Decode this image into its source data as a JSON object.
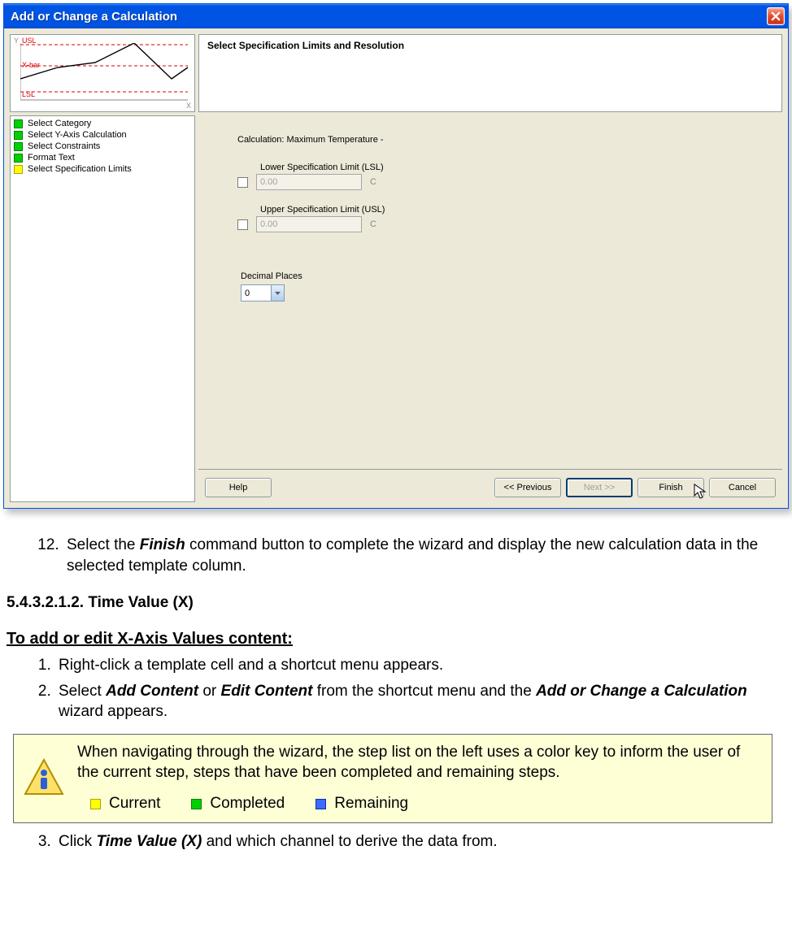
{
  "dialog": {
    "title": "Add or Change a Calculation",
    "header": "Select Specification Limits and Resolution",
    "chart": {
      "y": "Y",
      "usl": "USL",
      "xbar": "X-bar",
      "lsl": "LSL",
      "x": "X"
    },
    "steps": [
      {
        "color": "green",
        "label": "Select Category"
      },
      {
        "color": "green",
        "label": "Select Y-Axis Calculation"
      },
      {
        "color": "green",
        "label": "Select Constraints"
      },
      {
        "color": "green",
        "label": "Format Text"
      },
      {
        "color": "yellow",
        "label": "Select Specification Limits"
      }
    ],
    "form": {
      "calc_label": "Calculation: Maximum Temperature -",
      "lsl_label": "Lower Specification Limit (LSL)",
      "lsl_value": "0.00",
      "lsl_unit": "C",
      "usl_label": "Upper Specification Limit (USL)",
      "usl_value": "0.00",
      "usl_unit": "C",
      "decimal_label": "Decimal Places",
      "decimal_value": "0"
    },
    "buttons": {
      "help": "Help",
      "prev": "<< Previous",
      "next": "Next >>",
      "finish": "Finish",
      "cancel": "Cancel"
    }
  },
  "doc": {
    "step12_num": "12)",
    "step12_pre": "Select the ",
    "step12_bi": "Finish",
    "step12_post": " command button to complete the wizard and display the new calculation data in the selected template column.",
    "section": "5.4.3.2.1.2. Time Value (X)",
    "subhead": "To add or edit X-Axis Values content:",
    "s1": "Right-click a template cell and a shortcut menu appears.",
    "s2_pre": "Select ",
    "s2_b1": "Add Content",
    "s2_mid1": " or ",
    "s2_b2": "Edit Content",
    "s2_mid2": " from the shortcut menu and the ",
    "s2_b3": "Add or Change a Calculation",
    "s2_post": " wizard appears.",
    "note": "When navigating through the wizard, the step list on the left uses a color key to inform the user of the current step, steps that have been completed and remaining steps.",
    "legend": {
      "current": "Current",
      "completed": "Completed",
      "remaining": "Remaining"
    },
    "s3_pre": "Click ",
    "s3_b": "Time Value (X)",
    "s3_post": " and which channel to derive the data from."
  }
}
